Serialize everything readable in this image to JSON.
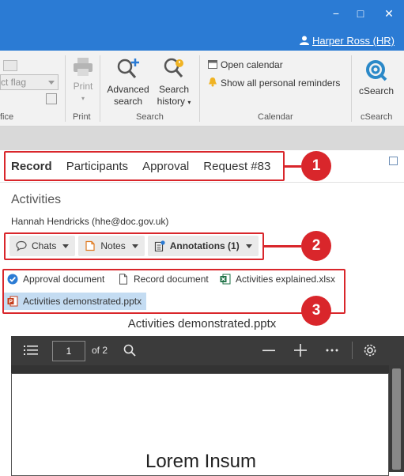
{
  "window": {
    "user_label": "Harper Ross (HR)",
    "controls": {
      "minimize": "−",
      "maximize": "□",
      "close": "✕"
    }
  },
  "ribbon": {
    "flag_select_value": "ct flag",
    "groups": {
      "office_label": "fice",
      "print_label": "Print",
      "search_label": "Search",
      "calendar_label": "Calendar",
      "csearch_label": "cSearch"
    },
    "print_button": "Print",
    "advanced_search": [
      "Advanced",
      "search"
    ],
    "search_history": [
      "Search",
      "history"
    ],
    "open_calendar": "Open calendar",
    "show_reminders": "Show all personal reminders",
    "csearch_button": "cSearch"
  },
  "tabs": [
    "Record",
    "Participants",
    "Approval",
    "Request #83"
  ],
  "activities": {
    "title": "Activities",
    "email": "Hannah Hendricks (hhe@doc.gov.uk)"
  },
  "filters": {
    "chats": "Chats",
    "notes": "Notes",
    "annotations": "Annotations (1)"
  },
  "documents": {
    "approval": "Approval document",
    "record": "Record document",
    "xlsx": "Activities explained.xlsx",
    "pptx": "Activities demonstrated.pptx"
  },
  "viewer": {
    "title": "Activities demonstrated.pptx",
    "page_number": "1",
    "of_pages": "of 2",
    "slide_text": "Lorem Insum"
  },
  "callouts": [
    "1",
    "2",
    "3"
  ],
  "colors": {
    "titlebar": "#2b7bd4",
    "callout_red": "#d9262b",
    "selection": "#c4dcf2"
  }
}
